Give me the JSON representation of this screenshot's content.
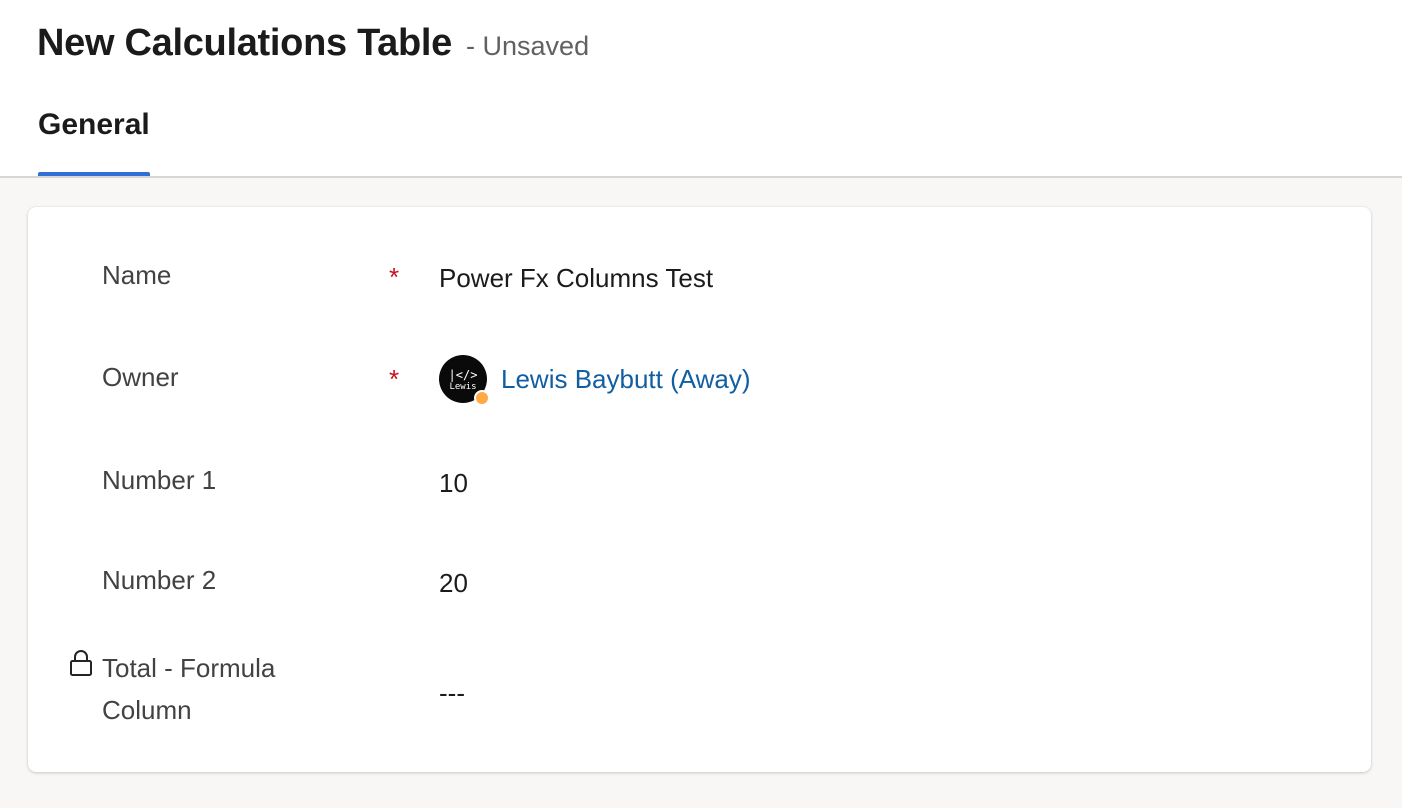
{
  "header": {
    "title": "New Calculations Table",
    "save_status": "- Unsaved"
  },
  "tabs": [
    {
      "label": "General",
      "selected": true
    }
  ],
  "form": {
    "fields": {
      "name": {
        "label": "Name",
        "required_mark": "*",
        "value": "Power Fx Columns Test"
      },
      "owner": {
        "label": "Owner",
        "required_mark": "*",
        "value": "Lewis Baybutt (Away)",
        "avatar_code": "|</>",
        "avatar_text": "Lewis",
        "presence": "away"
      },
      "number1": {
        "label": "Number 1",
        "value": "10"
      },
      "number2": {
        "label": "Number 2",
        "value": "20"
      },
      "total": {
        "label_line1": "Total - Formula",
        "label_line2": "Column",
        "value": "---",
        "locked": true
      }
    }
  },
  "colors": {
    "accent": "#2f6fd6",
    "link": "#115ea3",
    "required": "#c50f1f",
    "presence_away": "#ffaa44"
  },
  "icons": {
    "lock": "lock-icon"
  }
}
